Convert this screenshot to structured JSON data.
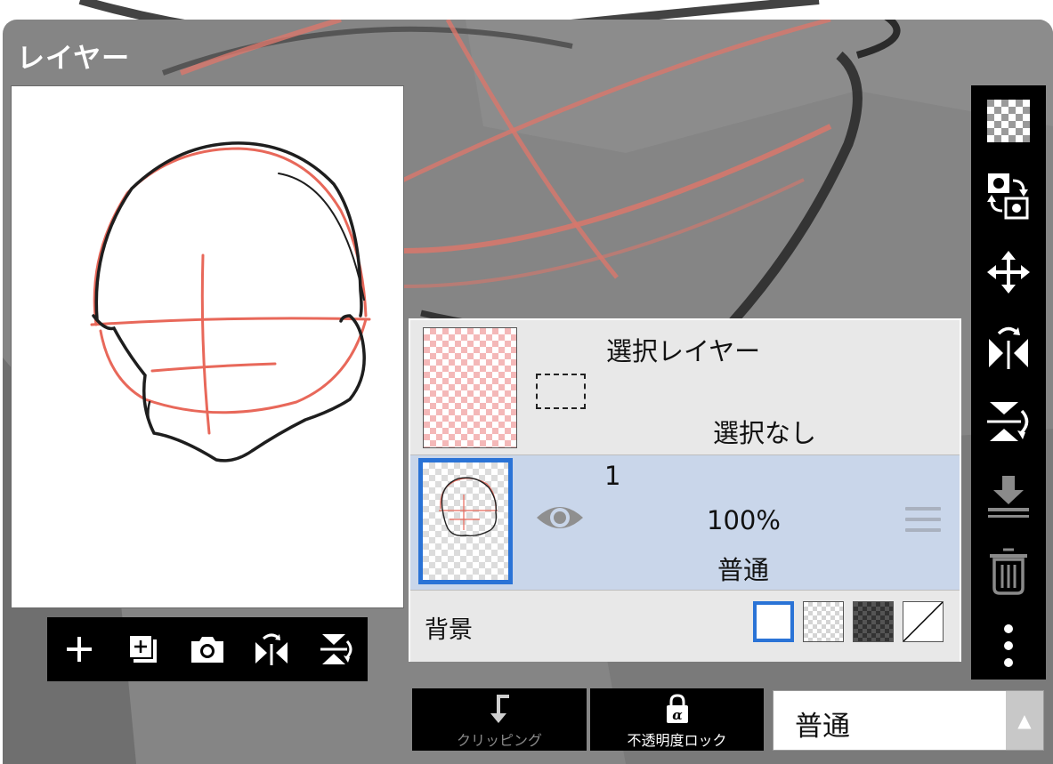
{
  "panel": {
    "title": "レイヤー"
  },
  "preview_toolbar": {
    "buttons": [
      {
        "name": "add-layer",
        "icon": "plus-icon"
      },
      {
        "name": "duplicate-layer",
        "icon": "duplicate-icon"
      },
      {
        "name": "import-photo",
        "icon": "camera-icon"
      },
      {
        "name": "flip-horizontal",
        "icon": "flip-horizontal-icon"
      },
      {
        "name": "flip-vertical",
        "icon": "flip-vertical-icon"
      }
    ]
  },
  "layers": {
    "selection_layer": {
      "name": "選択レイヤー",
      "status": "選択なし"
    },
    "layer_1": {
      "name": "1",
      "opacity": "100%",
      "blend_mode": "普通",
      "visible": true,
      "selected": true
    },
    "background": {
      "label": "背景",
      "swatches": [
        "white",
        "light-transparent",
        "dark-transparent",
        "none"
      ],
      "selected": "white"
    }
  },
  "right_toolbar": {
    "buttons": [
      "transparency-icon",
      "swap-layers-icon",
      "move-icon",
      "flip-horizontal-icon",
      "flip-vertical-icon",
      "merge-down-icon",
      "trash-icon",
      "more-icon"
    ]
  },
  "bottom": {
    "clipping_label": "クリッピング",
    "alpha_lock_label": "不透明度ロック",
    "blend_mode_value": "普通"
  },
  "colors": {
    "accent": "#2a73d6",
    "sketch_red": "#e8685a",
    "selected_row": "#c9d6ea",
    "panel_gray": "#858585"
  }
}
